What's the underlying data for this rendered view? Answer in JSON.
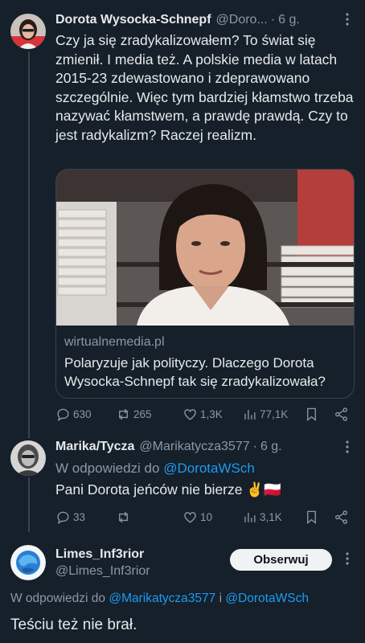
{
  "tweet1": {
    "name": "Dorota Wysocka-Schnepf",
    "handle": "@Doro...",
    "sep": "·",
    "time": "6 g.",
    "text": "Czy ja się zradykalizowałem? To świat się zmienił. I media też. A polskie media w latach 2015-23 zdewastowano i zdeprawowano szczególnie. Więc tym bardziej kłamstwo trzeba nazywać kłamstwem, a prawdę prawdą. Czy to jest radykalizm? Raczej realizm.",
    "card": {
      "domain": "wirtualnemedia.pl",
      "title": "Polaryzuje jak polityczy. Dlaczego Dorota Wysocka-Schnepf tak się zradykalizowała?"
    },
    "stats": {
      "replies": "630",
      "reposts": "265",
      "likes": "1,3K",
      "views": "77,1K"
    }
  },
  "tweet2": {
    "name": "Marika/Tycza",
    "handle": "@Marikatycza3577",
    "sep": "·",
    "time": "6 g.",
    "reply_prefix": "W odpowiedzi do",
    "reply_to": "@DorotaWSch",
    "text": "Pani Dorota jeńców nie bierze ✌️🇵🇱",
    "stats": {
      "replies": "33",
      "reposts": "",
      "likes": "10",
      "views": "3,1K"
    }
  },
  "tweet3": {
    "name": "Limes_Inf3rior",
    "handle": "@Limes_Inf3rior",
    "follow_label": "Obserwuj",
    "reply_prefix": "W odpowiedzi do",
    "reply_to_1": "@Marikatycza3577",
    "reply_and": "i",
    "reply_to_2": "@DorotaWSch",
    "text": "Teściu też nie brał."
  },
  "more_glyph": "• • •",
  "colors": {
    "background": "#15202b",
    "text": "#e7e9ea",
    "muted": "#8b98a5",
    "link": "#1d9bf0",
    "border": "#38444d"
  }
}
